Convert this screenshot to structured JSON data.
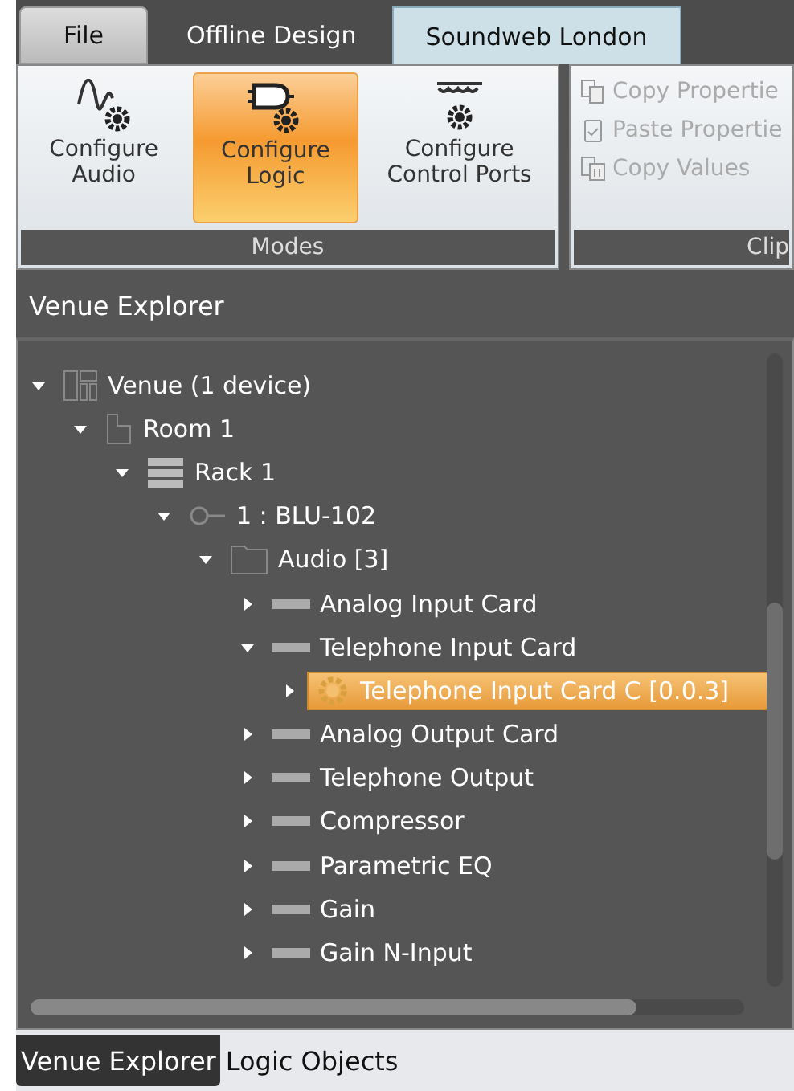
{
  "ribbon_tabs": [
    {
      "label": "File",
      "kind": "file",
      "selected": false
    },
    {
      "label": "Offline Design",
      "kind": "tab",
      "selected": false
    },
    {
      "label": "Soundweb London",
      "kind": "tab",
      "selected": true
    }
  ],
  "modes": {
    "buttons": [
      {
        "label": "Configure Audio",
        "kind": "audio",
        "selected": false
      },
      {
        "label": "Configure Logic",
        "kind": "logic",
        "selected": true
      },
      {
        "label": "Configure Control Ports",
        "kind": "ports",
        "selected": false
      }
    ],
    "group_label": "Modes"
  },
  "clipboard": {
    "items": [
      {
        "label": "Copy Propertie",
        "kind": "copy",
        "disabled": true
      },
      {
        "label": "Paste Propertie",
        "kind": "paste",
        "disabled": true
      },
      {
        "label": "Copy Values",
        "kind": "values",
        "disabled": true
      }
    ],
    "group_label": "Clip"
  },
  "panel_title": "Venue Explorer",
  "tree": [
    {
      "label": "Venue (1 device)",
      "kind": "venue",
      "expanded": true,
      "selected": false,
      "children": [
        {
          "label": "Room 1",
          "kind": "room",
          "expanded": true,
          "selected": false,
          "children": [
            {
              "label": "Rack 1",
              "kind": "rack",
              "expanded": true,
              "selected": false,
              "children": [
                {
                  "label": "1 : BLU-102",
                  "kind": "device",
                  "expanded": true,
                  "selected": false,
                  "children": [
                    {
                      "label": "Audio [3]",
                      "kind": "folder",
                      "expanded": true,
                      "selected": false,
                      "children": [
                        {
                          "label": "Analog Input Card",
                          "kind": "card",
                          "expanded": false,
                          "selected": false
                        },
                        {
                          "label": "Telephone Input Card",
                          "kind": "card",
                          "expanded": true,
                          "selected": false,
                          "children": [
                            {
                              "label": "Telephone Input Card C [0.0.3]",
                              "kind": "gear",
                              "expanded": false,
                              "selected": true
                            }
                          ]
                        },
                        {
                          "label": "Analog Output Card",
                          "kind": "card",
                          "expanded": false,
                          "selected": false
                        },
                        {
                          "label": "Telephone Output",
                          "kind": "card",
                          "expanded": false,
                          "selected": false
                        },
                        {
                          "label": "Compressor",
                          "kind": "card",
                          "expanded": false,
                          "selected": false
                        },
                        {
                          "label": "Parametric EQ",
                          "kind": "card",
                          "expanded": false,
                          "selected": false
                        },
                        {
                          "label": "Gain",
                          "kind": "card",
                          "expanded": false,
                          "selected": false
                        },
                        {
                          "label": "Gain N-Input",
                          "kind": "card",
                          "expanded": false,
                          "selected": false
                        }
                      ]
                    }
                  ]
                }
              ]
            }
          ]
        }
      ]
    }
  ],
  "bottom_tabs": [
    {
      "label": "Venue Explorer",
      "selected": true
    },
    {
      "label": "Logic Objects",
      "selected": false
    }
  ]
}
